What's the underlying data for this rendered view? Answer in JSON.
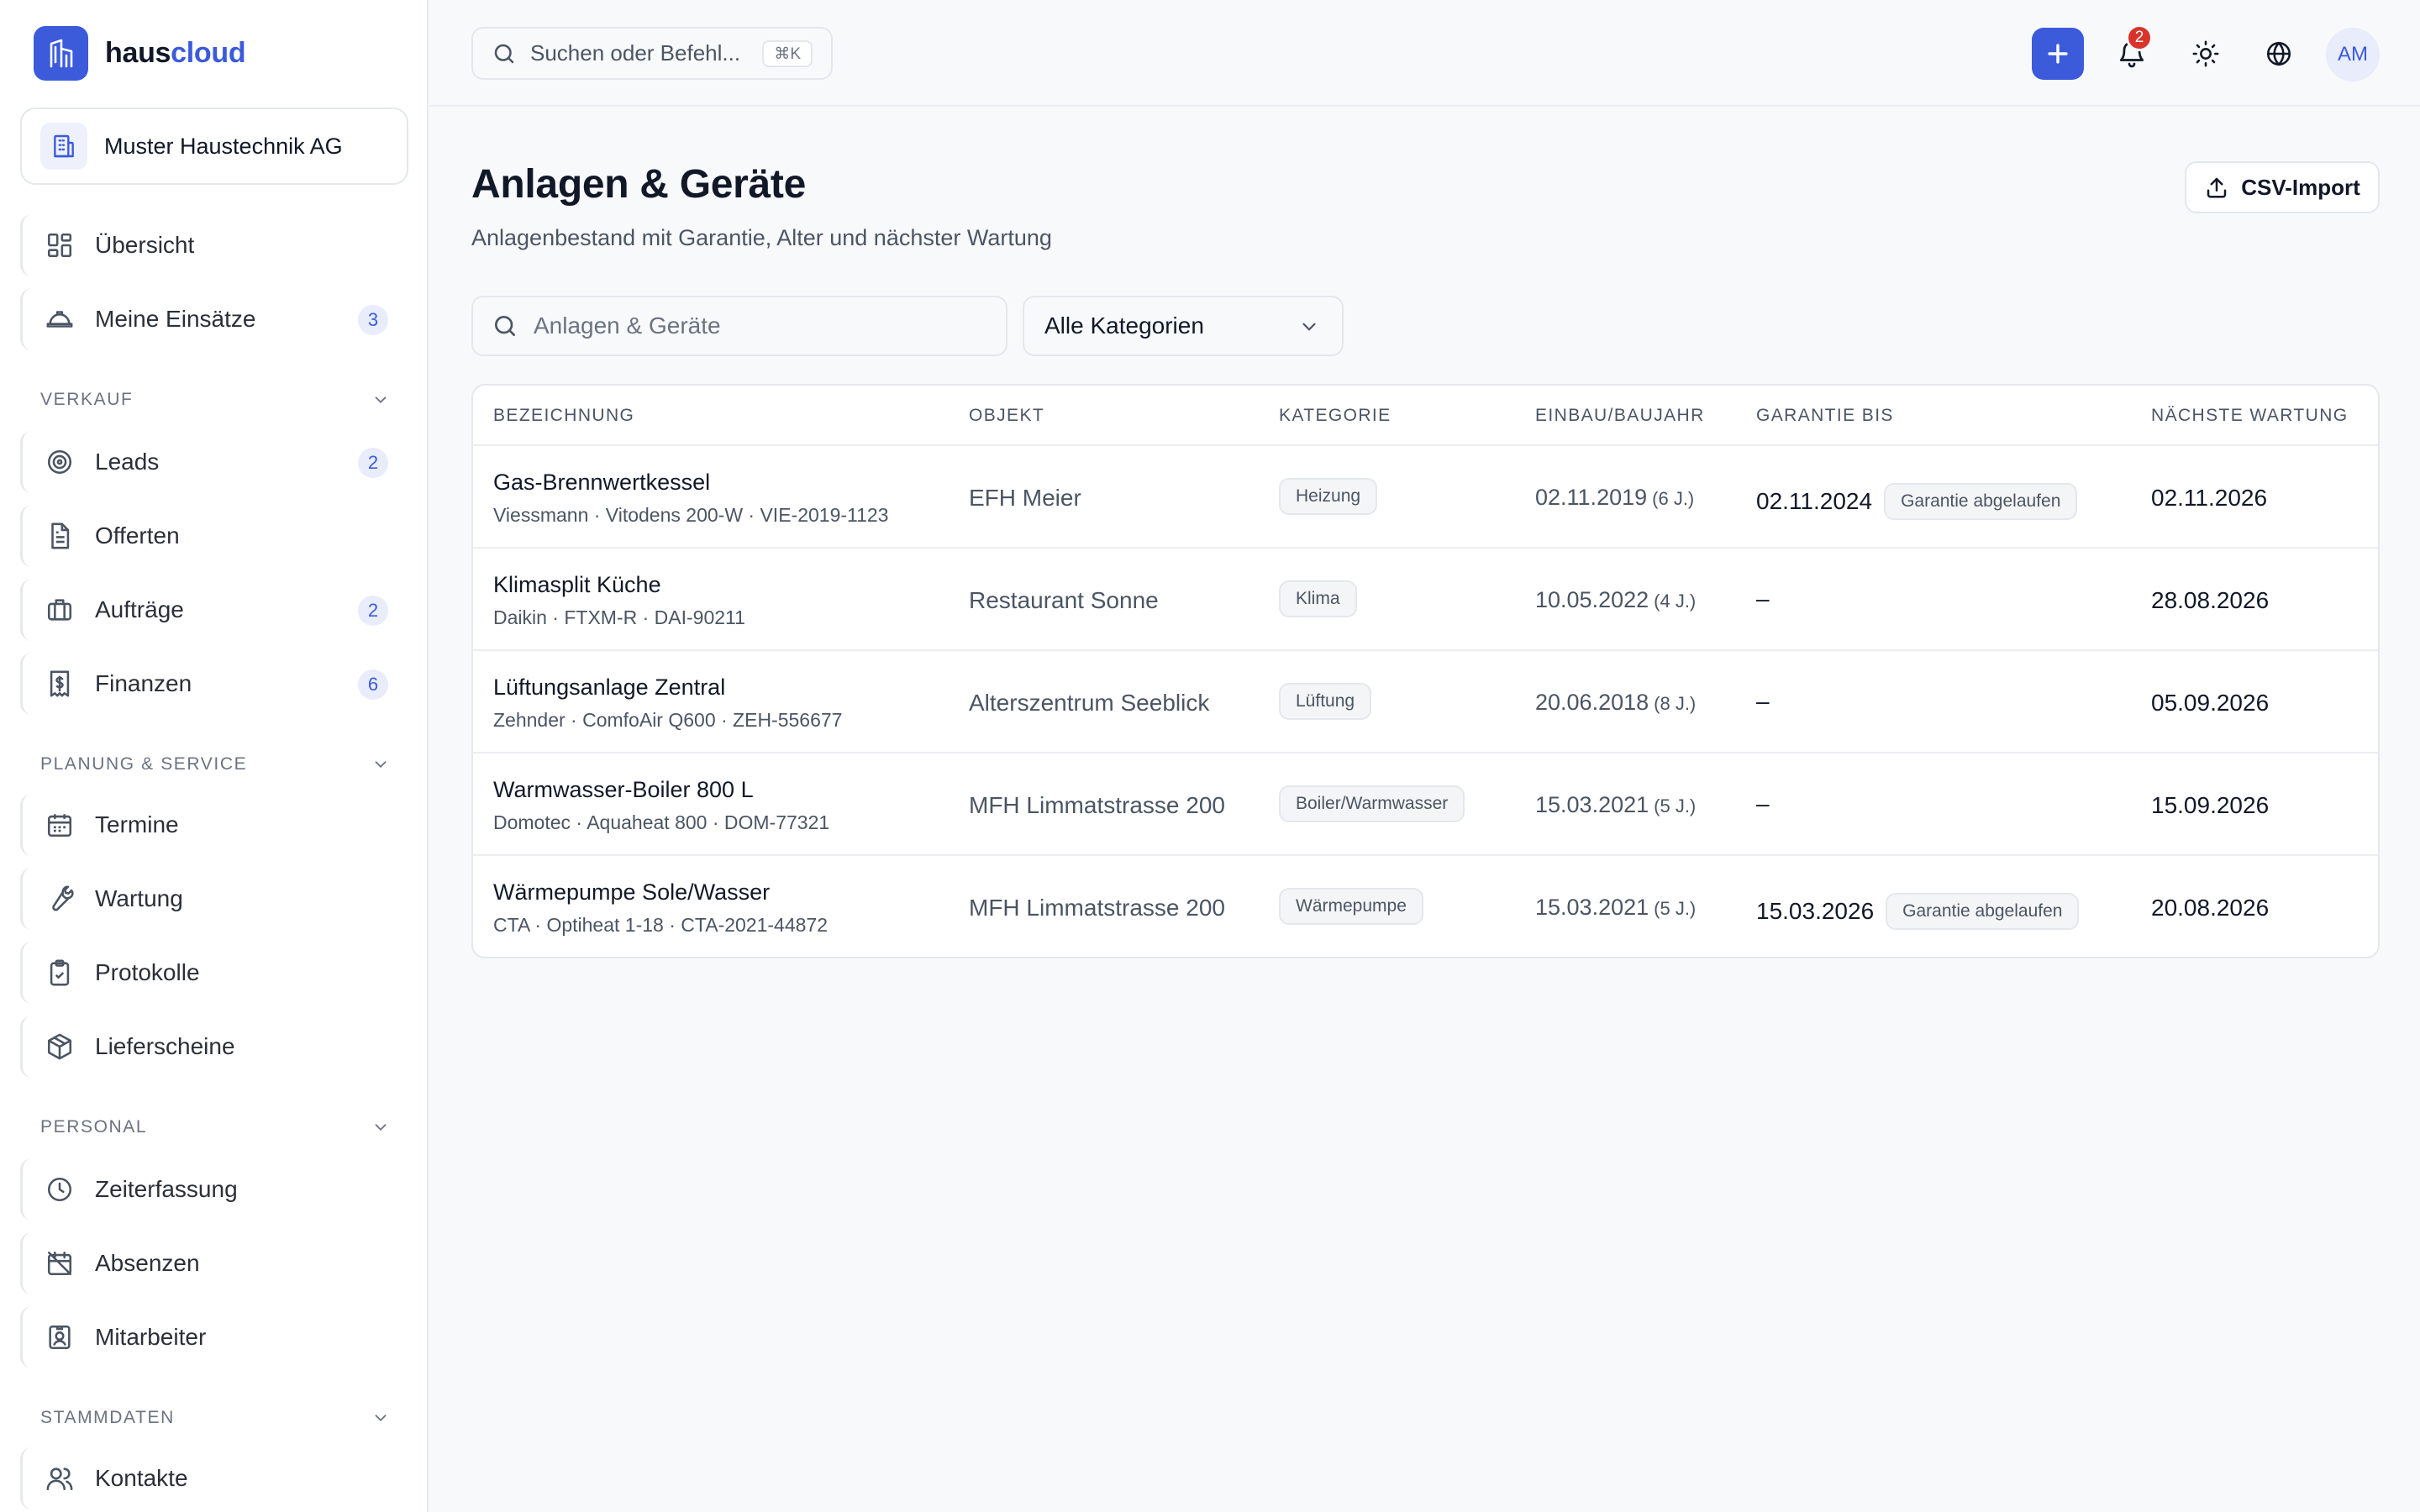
{
  "brand": {
    "name_part1": "haus",
    "name_part2": "cloud"
  },
  "org": {
    "name": "Muster Haustechnik AG"
  },
  "search": {
    "placeholder": "Suchen oder Befehl...",
    "shortcut": "⌘K"
  },
  "notifications": {
    "count": "2"
  },
  "user": {
    "initials": "AM"
  },
  "sidebar": {
    "top_items": [
      {
        "label": "Übersicht",
        "icon": "dashboard-icon",
        "badge": ""
      },
      {
        "label": "Meine Einsätze",
        "icon": "helmet-icon",
        "badge": "3"
      }
    ],
    "sections": [
      {
        "title": "VERKAUF",
        "items": [
          {
            "label": "Leads",
            "icon": "target-icon",
            "badge": "2"
          },
          {
            "label": "Offerten",
            "icon": "document-icon",
            "badge": ""
          },
          {
            "label": "Aufträge",
            "icon": "briefcase-icon",
            "badge": "2"
          },
          {
            "label": "Finanzen",
            "icon": "receipt-icon",
            "badge": "6"
          }
        ]
      },
      {
        "title": "PLANUNG & SERVICE",
        "items": [
          {
            "label": "Termine",
            "icon": "calendar-icon",
            "badge": ""
          },
          {
            "label": "Wartung",
            "icon": "wrench-icon",
            "badge": ""
          },
          {
            "label": "Protokolle",
            "icon": "clipboard-check-icon",
            "badge": ""
          },
          {
            "label": "Lieferscheine",
            "icon": "package-icon",
            "badge": ""
          }
        ]
      },
      {
        "title": "PERSONAL",
        "items": [
          {
            "label": "Zeiterfassung",
            "icon": "clock-icon",
            "badge": ""
          },
          {
            "label": "Absenzen",
            "icon": "calendar-off-icon",
            "badge": ""
          },
          {
            "label": "Mitarbeiter",
            "icon": "id-badge-icon",
            "badge": ""
          }
        ]
      },
      {
        "title": "STAMMDATEN",
        "items": [
          {
            "label": "Kontakte",
            "icon": "users-icon",
            "badge": ""
          }
        ]
      }
    ]
  },
  "page": {
    "title": "Anlagen & Geräte",
    "subtitle": "Anlagenbestand mit Garantie, Alter und nächster Wartung",
    "csv_button": "CSV-Import",
    "filter_placeholder": "Anlagen & Geräte",
    "category_select": "Alle Kategorien"
  },
  "table": {
    "columns": [
      "BEZEICHNUNG",
      "OBJEKT",
      "KATEGORIE",
      "EINBAU/BAUJAHR",
      "GARANTIE BIS",
      "NÄCHSTE WARTUNG"
    ],
    "rows": [
      {
        "name": "Gas-Brennwertkessel",
        "meta": "Viessmann · Vitodens 200-W · VIE-2019-1123",
        "object": "EFH Meier",
        "category": "Heizung",
        "install": "02.11.2019",
        "age": "(6 J.)",
        "warranty": "02.11.2024",
        "warranty_tag": "Garantie abgelaufen",
        "next_service": "02.11.2026"
      },
      {
        "name": "Klimasplit Küche",
        "meta": "Daikin · FTXM-R · DAI-90211",
        "object": "Restaurant Sonne",
        "category": "Klima",
        "install": "10.05.2022",
        "age": "(4 J.)",
        "warranty": "–",
        "warranty_tag": "",
        "next_service": "28.08.2026"
      },
      {
        "name": "Lüftungsanlage Zentral",
        "meta": "Zehnder · ComfoAir Q600 · ZEH-556677",
        "object": "Alterszentrum Seeblick",
        "category": "Lüftung",
        "install": "20.06.2018",
        "age": "(8 J.)",
        "warranty": "–",
        "warranty_tag": "",
        "next_service": "05.09.2026"
      },
      {
        "name": "Warmwasser-Boiler 800 L",
        "meta": "Domotec · Aquaheat 800 · DOM-77321",
        "object": "MFH Limmatstrasse 200",
        "category": "Boiler/Warmwasser",
        "install": "15.03.2021",
        "age": "(5 J.)",
        "warranty": "–",
        "warranty_tag": "",
        "next_service": "15.09.2026"
      },
      {
        "name": "Wärmepumpe Sole/Wasser",
        "meta": "CTA · Optiheat 1-18 · CTA-2021-44872",
        "object": "MFH Limmatstrasse 200",
        "category": "Wärmepumpe",
        "install": "15.03.2021",
        "age": "(5 J.)",
        "warranty": "15.03.2026",
        "warranty_tag": "Garantie abgelaufen",
        "next_service": "20.08.2026"
      }
    ]
  },
  "colors": {
    "accent": "#3b5bdb",
    "notification": "#d9342b"
  }
}
